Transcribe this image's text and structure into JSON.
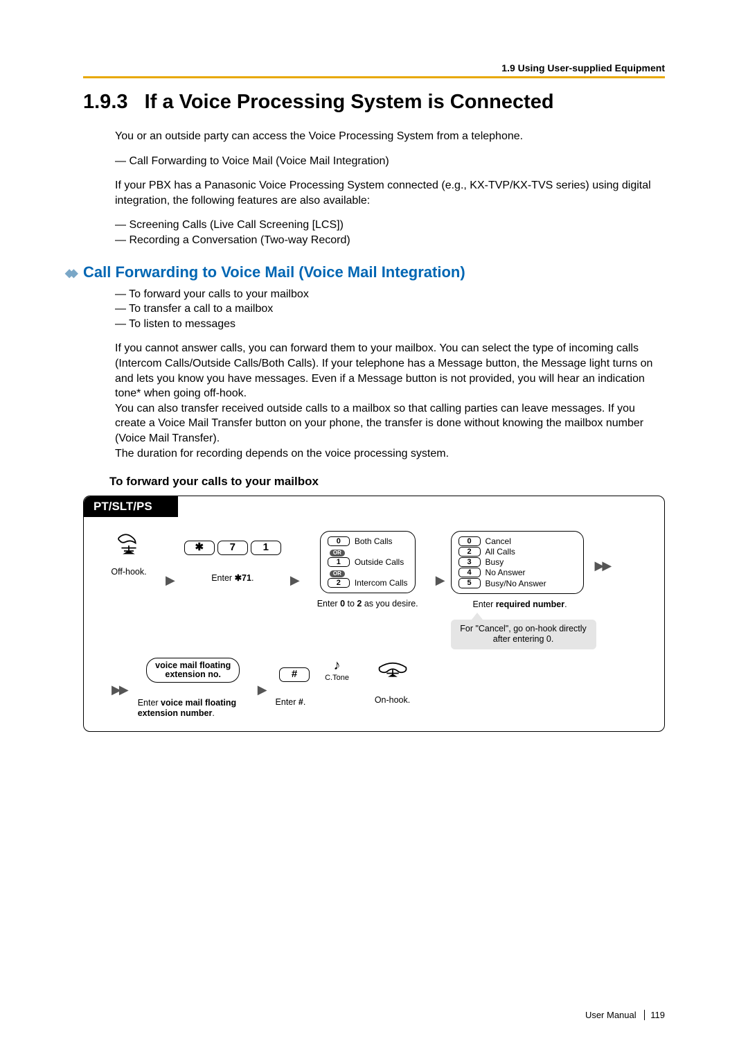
{
  "header": {
    "section": "1.9 Using User-supplied Equipment"
  },
  "title": {
    "number": "1.9.3",
    "text": "If a Voice Processing System is Connected"
  },
  "intro": {
    "p1": "You or an outside party can access the Voice Processing System from a telephone.",
    "list1": [
      "Call Forwarding to Voice Mail (Voice Mail Integration)"
    ],
    "p2": "If your PBX has a Panasonic Voice Processing System connected (e.g., KX-TVP/KX-TVS series) using digital integration, the following features are also available:",
    "list2": [
      "Screening Calls (Live Call Screening [LCS])",
      "Recording a Conversation (Two-way Record)"
    ]
  },
  "subsection": {
    "title": "Call Forwarding to Voice Mail (Voice Mail Integration)"
  },
  "sublist": [
    "To forward your calls to your mailbox",
    "To transfer a call to a mailbox",
    "To listen to messages"
  ],
  "body": {
    "p1": "If you cannot answer calls, you can forward them to your mailbox. You can select the type of incoming calls (Intercom Calls/Outside Calls/Both Calls). If your telephone has a Message button, the Message light turns on and lets you know you have messages. Even if a Message button is not provided, you will hear an indication tone* when going off-hook.",
    "p2": "You can also transfer received outside calls to a mailbox so that calling parties can leave messages. If you create a Voice Mail Transfer button on your phone, the transfer is done without knowing the mailbox number (Voice Mail Transfer).",
    "p3": "The duration for recording depends on the voice processing system."
  },
  "procedure": {
    "title": "To forward your calls to your mailbox",
    "tab": "PT/SLT/PS",
    "row1": {
      "step1": {
        "caption": "Off-hook."
      },
      "step2": {
        "keys": [
          "✱",
          "7",
          "1"
        ],
        "caption_pre": "Enter ",
        "caption_bold": "✱71",
        "caption_post": "."
      },
      "step3": {
        "options": [
          {
            "key": "0",
            "label": "Both Calls"
          },
          {
            "key": "1",
            "label": "Outside Calls"
          },
          {
            "key": "2",
            "label": "Intercom Calls"
          }
        ],
        "or": "OR",
        "caption_pre": "Enter ",
        "caption_bold1": "0",
        "caption_mid": " to ",
        "caption_bold2": "2",
        "caption_post": " as you desire."
      },
      "step4": {
        "options": [
          {
            "key": "0",
            "label": "Cancel"
          },
          {
            "key": "2",
            "label": "All Calls"
          },
          {
            "key": "3",
            "label": "Busy"
          },
          {
            "key": "4",
            "label": "No Answer"
          },
          {
            "key": "5",
            "label": "Busy/No Answer"
          }
        ],
        "caption_pre": "Enter ",
        "caption_bold": "required number",
        "caption_post": ".",
        "callout": "For \"Cancel\", go on-hook directly after entering 0."
      }
    },
    "row2": {
      "step1": {
        "oval_l1": "voice mail floating",
        "oval_l2": "extension no.",
        "caption_pre": "Enter ",
        "caption_bold": "voice mail floating extension number",
        "caption_post": "."
      },
      "step2": {
        "key": "#",
        "ctone": "C.Tone",
        "caption_pre": "Enter ",
        "caption_bold": "#",
        "caption_post": "."
      },
      "step3": {
        "caption": "On-hook."
      }
    }
  },
  "footer": {
    "label": "User Manual",
    "page": "119"
  }
}
